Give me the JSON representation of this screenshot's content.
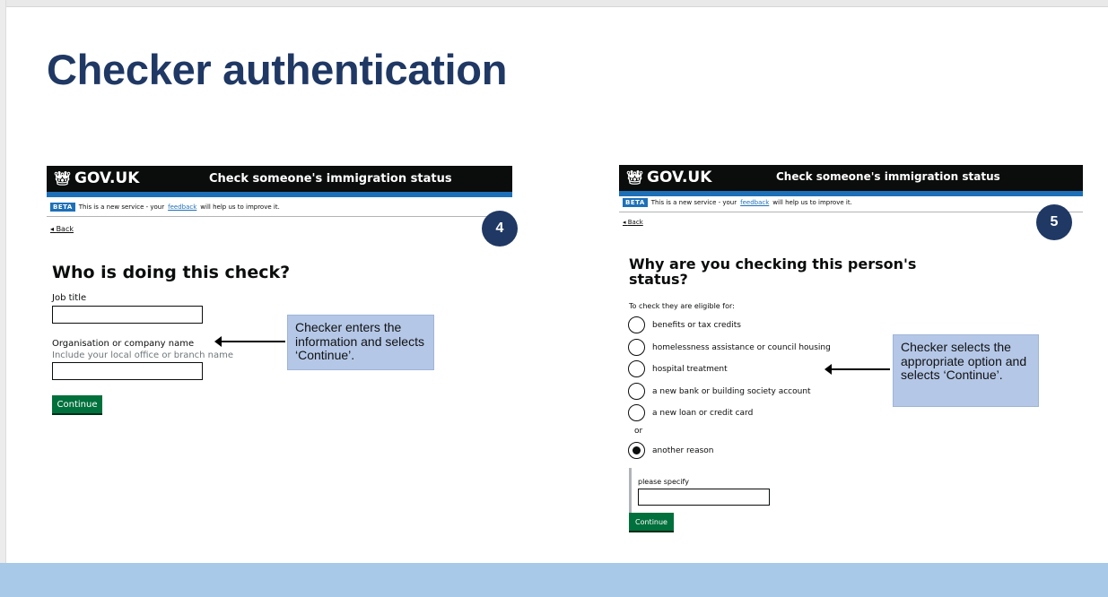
{
  "slide": {
    "title": "Checker authentication"
  },
  "gov": {
    "logo_text": "GOV.UK",
    "service_name": "Check someone's immigration status",
    "beta_tag": "BETA",
    "beta_prefix": "This is a new service - your",
    "beta_link": "feedback",
    "beta_suffix": "will help us to improve it.",
    "back_label": "Back"
  },
  "panel_left": {
    "step": "4",
    "heading": "Who is doing this check?",
    "job_title_label": "Job title",
    "job_title_value": "",
    "org_label": "Organisation or company name",
    "org_hint": "Include your local office or branch name",
    "org_value": "",
    "continue_label": "Continue",
    "callout": "Checker enters the information and selects ‘Continue’."
  },
  "panel_right": {
    "step": "5",
    "heading_line1": "Why are you checking this person's",
    "heading_line2": "status?",
    "intro": "To check they are eligible for:",
    "options": [
      "benefits or tax credits",
      "homelessness assistance or council housing",
      "hospital treatment",
      "a new bank or building society account",
      "a new loan or credit card"
    ],
    "or_label": "or",
    "other_option": "another reason",
    "other_selected": true,
    "specify_label": "please specify",
    "specify_value": "",
    "continue_label": "Continue",
    "callout": "Checker selects the appropriate option and selects ‘Continue’."
  },
  "colors": {
    "title": "#1f3864",
    "badge": "#1f3864",
    "gov_black": "#0b0c0c",
    "gov_blue": "#1d70b8",
    "gov_green": "#00703c",
    "callout": "#b4c7e7",
    "footer_band": "#a8c9e8"
  }
}
